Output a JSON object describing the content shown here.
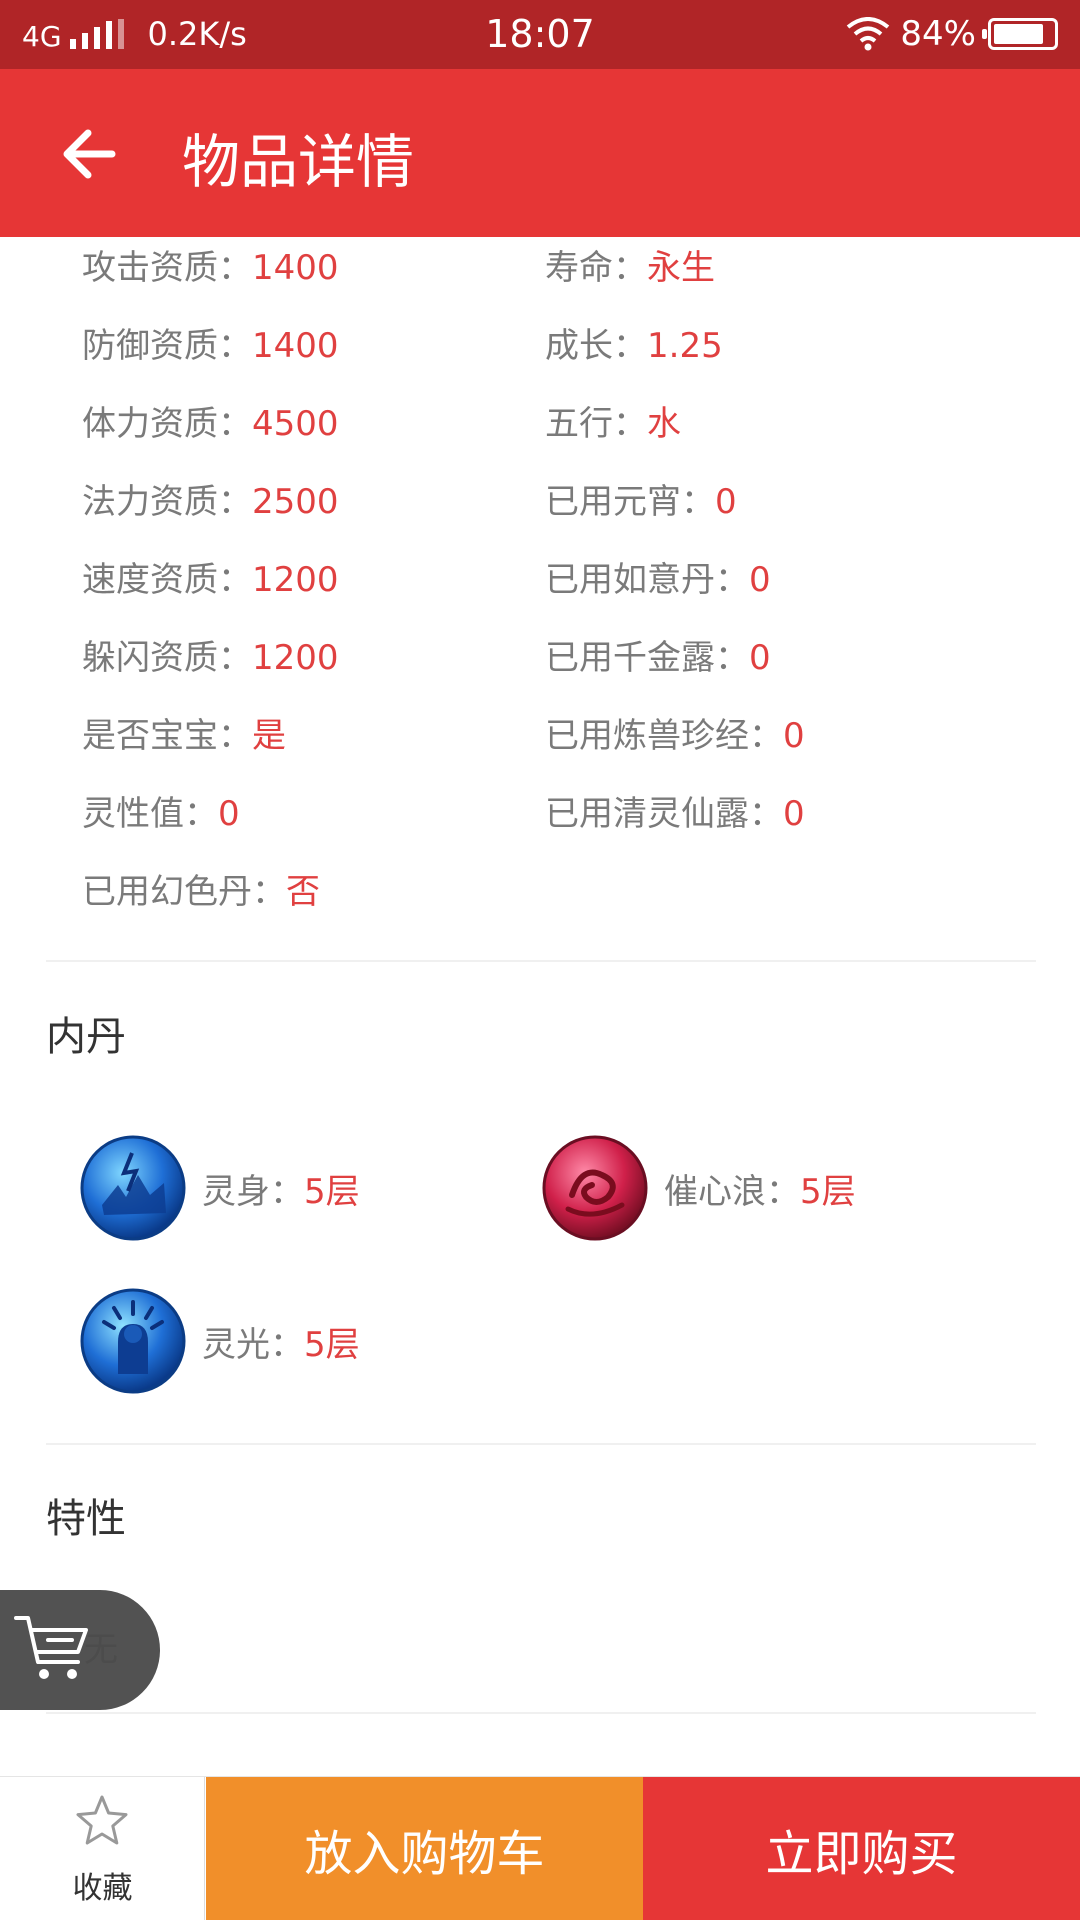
{
  "status_bar": {
    "network": "4G",
    "speed": "0.2K/s",
    "time": "18:07",
    "battery": "84%",
    "battery_level": 0.84
  },
  "header": {
    "back_icon": "arrow-left-icon",
    "title": "物品详情"
  },
  "attributes": {
    "left": [
      {
        "label": "攻击资质：",
        "value": "1400"
      },
      {
        "label": "防御资质：",
        "value": "1400"
      },
      {
        "label": "体力资质：",
        "value": "4500"
      },
      {
        "label": "法力资质：",
        "value": "2500"
      },
      {
        "label": "速度资质：",
        "value": "1200"
      },
      {
        "label": "躲闪资质：",
        "value": "1200"
      },
      {
        "label": "是否宝宝：",
        "value": "是"
      },
      {
        "label": "灵性值：",
        "value": "0"
      },
      {
        "label": "已用幻色丹：",
        "value": "否"
      }
    ],
    "right": [
      {
        "label": "寿命：",
        "value": "永生"
      },
      {
        "label": "成长：",
        "value": "1.25"
      },
      {
        "label": "五行：",
        "value": "水"
      },
      {
        "label": "已用元宵：",
        "value": "0"
      },
      {
        "label": "已用如意丹：",
        "value": "0"
      },
      {
        "label": "已用千金露：",
        "value": "0"
      },
      {
        "label": "已用炼兽珍经：",
        "value": "0"
      },
      {
        "label": "已用清灵仙露：",
        "value": "0"
      }
    ]
  },
  "neidan": {
    "title": "内丹",
    "items": [
      {
        "icon": "lingshen-orb-icon",
        "name": "灵身：",
        "level": "5层",
        "color": "#1f6fd6"
      },
      {
        "icon": "cuixinlang-orb-icon",
        "name": "催心浪：",
        "level": "5层",
        "color": "#d0204a"
      },
      {
        "icon": "lingguang-orb-icon",
        "name": "灵光：",
        "level": "5层",
        "color": "#1f6fd6"
      }
    ]
  },
  "traits": {
    "title": "特性",
    "value": "无"
  },
  "cart_fab": {
    "icon": "cart-icon"
  },
  "bottom_bar": {
    "favorite_icon": "star-icon",
    "favorite_label": "收藏",
    "add_to_cart": "放入购物车",
    "buy_now": "立即购买"
  },
  "colors": {
    "status_bar": "#b02527",
    "header": "#e63636",
    "value_text": "#e04040",
    "cart_button": "#f18f2a",
    "buy_button": "#e63636"
  }
}
